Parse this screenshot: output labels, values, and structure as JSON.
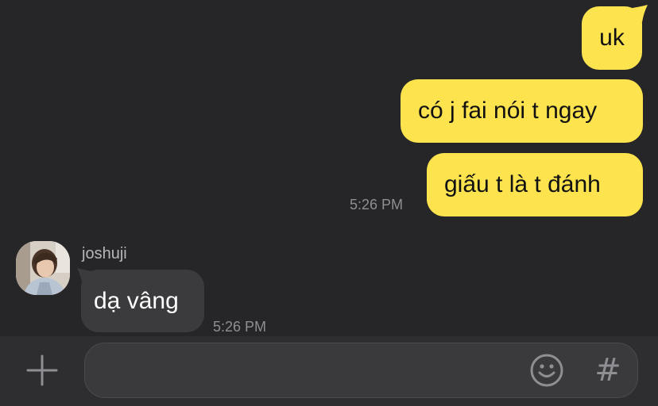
{
  "messages": {
    "outgoing": [
      {
        "text": "uk"
      },
      {
        "text": "có j fai nói t ngay"
      },
      {
        "text": "giấu t là t đánh"
      }
    ],
    "outgoing_time": "5:26 PM",
    "incoming": {
      "sender": "joshuji",
      "text": "dạ vâng",
      "time": "5:26 PM"
    }
  },
  "input_bar": {
    "placeholder": "",
    "icons": [
      "plus-icon",
      "emoji-icon",
      "hashtag-icon"
    ],
    "hash_glyph": "#"
  },
  "colors": {
    "background": "#262628",
    "outgoing_bubble": "#fde44f",
    "incoming_bubble": "#3b3b3d",
    "input_bar": "#2e2e30"
  }
}
